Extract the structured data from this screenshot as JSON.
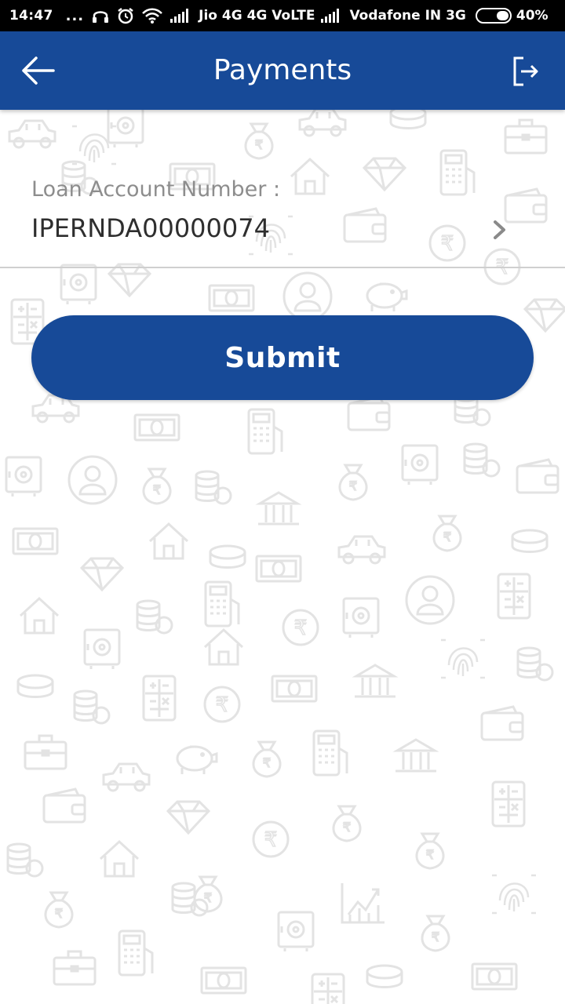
{
  "status_bar": {
    "time": "14:47",
    "dots": "...",
    "carrier1": "Jio 4G 4G VoLTE",
    "carrier2": "Vodafone IN 3G",
    "battery": "40%",
    "battery_level": 0.4,
    "icons": [
      "headphones-icon",
      "alarm-icon",
      "wifi-icon",
      "signal-icon",
      "signal-icon",
      "battery-icon"
    ]
  },
  "app_bar": {
    "title": "Payments",
    "back_icon": "arrow-left-icon",
    "logout_icon": "logout-icon",
    "color": "#174a98"
  },
  "loan_account": {
    "label": "Loan Account Number :",
    "value": "IPERNDA00000074",
    "chevron_icon": "chevron-right-icon"
  },
  "submit": {
    "label": "Submit",
    "color": "#174a98"
  },
  "background": {
    "pattern_icons": [
      "money-bag-icon",
      "piggy-bank-icon",
      "bank-icon",
      "coins-icon",
      "calculator-icon",
      "wallet-icon",
      "house-icon",
      "car-icon",
      "diamond-icon",
      "fingerprint-icon",
      "card-machine-icon",
      "rupee-icon",
      "safe-icon",
      "briefcase-icon",
      "user-icon",
      "banknote-icon",
      "chart-icon"
    ]
  }
}
